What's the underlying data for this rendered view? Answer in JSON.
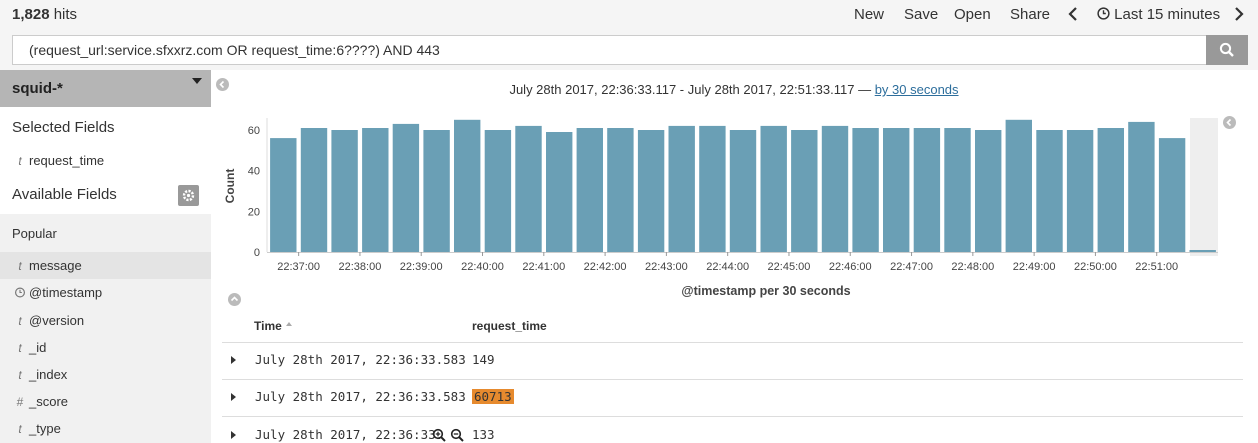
{
  "topbar": {
    "hits_count": "1,828",
    "hits_label": "hits",
    "nav": [
      "New",
      "Save",
      "Open",
      "Share"
    ],
    "time_range": "Last 15 minutes"
  },
  "query": {
    "value": "(request_url:service.sfxxrz.com OR request_time:6????) AND 443"
  },
  "sidebar": {
    "index_pattern": "squid-*",
    "selected_heading": "Selected Fields",
    "selected_fields": [
      {
        "type": "t",
        "name": "request_time"
      }
    ],
    "available_heading": "Available Fields",
    "popular_heading": "Popular",
    "available_fields": [
      {
        "type": "t",
        "name": "message"
      },
      {
        "type": "clock",
        "name": "@timestamp"
      },
      {
        "type": "t",
        "name": "@version"
      },
      {
        "type": "t",
        "name": "_id"
      },
      {
        "type": "t",
        "name": "_index"
      },
      {
        "type": "#",
        "name": "_score"
      },
      {
        "type": "t",
        "name": "_type"
      }
    ]
  },
  "histogram": {
    "range_text": "July 28th 2017, 22:36:33.117 - July 28th 2017, 22:51:33.117 —",
    "interval_link": "by 30 seconds"
  },
  "chart_data": {
    "type": "bar",
    "ylabel": "Count",
    "xlabel": "@timestamp per 30 seconds",
    "ylim": [
      0,
      70
    ],
    "yticks": [
      0,
      20,
      40,
      60
    ],
    "xtick_labels": [
      "22:37:00",
      "22:38:00",
      "22:39:00",
      "22:40:00",
      "22:41:00",
      "22:42:00",
      "22:43:00",
      "22:44:00",
      "22:45:00",
      "22:46:00",
      "22:47:00",
      "22:48:00",
      "22:49:00",
      "22:50:00",
      "22:51:00"
    ],
    "values": [
      56,
      61,
      60,
      61,
      63,
      60,
      65,
      60,
      62,
      59,
      61,
      61,
      60,
      62,
      62,
      60,
      62,
      60,
      62,
      61,
      61,
      61,
      61,
      60,
      65,
      60,
      60,
      61,
      64,
      56,
      1
    ],
    "bar_color": "#6a9fb5"
  },
  "table": {
    "col_time": "Time",
    "col_rt": "request_time",
    "rows": [
      {
        "time": "July 28th 2017, 22:36:33.583",
        "value": "149",
        "highlight": false
      },
      {
        "time": "July 28th 2017, 22:36:33.583",
        "value": "60713",
        "highlight": true
      },
      {
        "time": "July 28th 2017, 22:36:33.",
        "value": "133",
        "highlight": false
      }
    ]
  },
  "colors": {
    "highlight": "#e68a2e",
    "link": "#2d6e9c"
  }
}
